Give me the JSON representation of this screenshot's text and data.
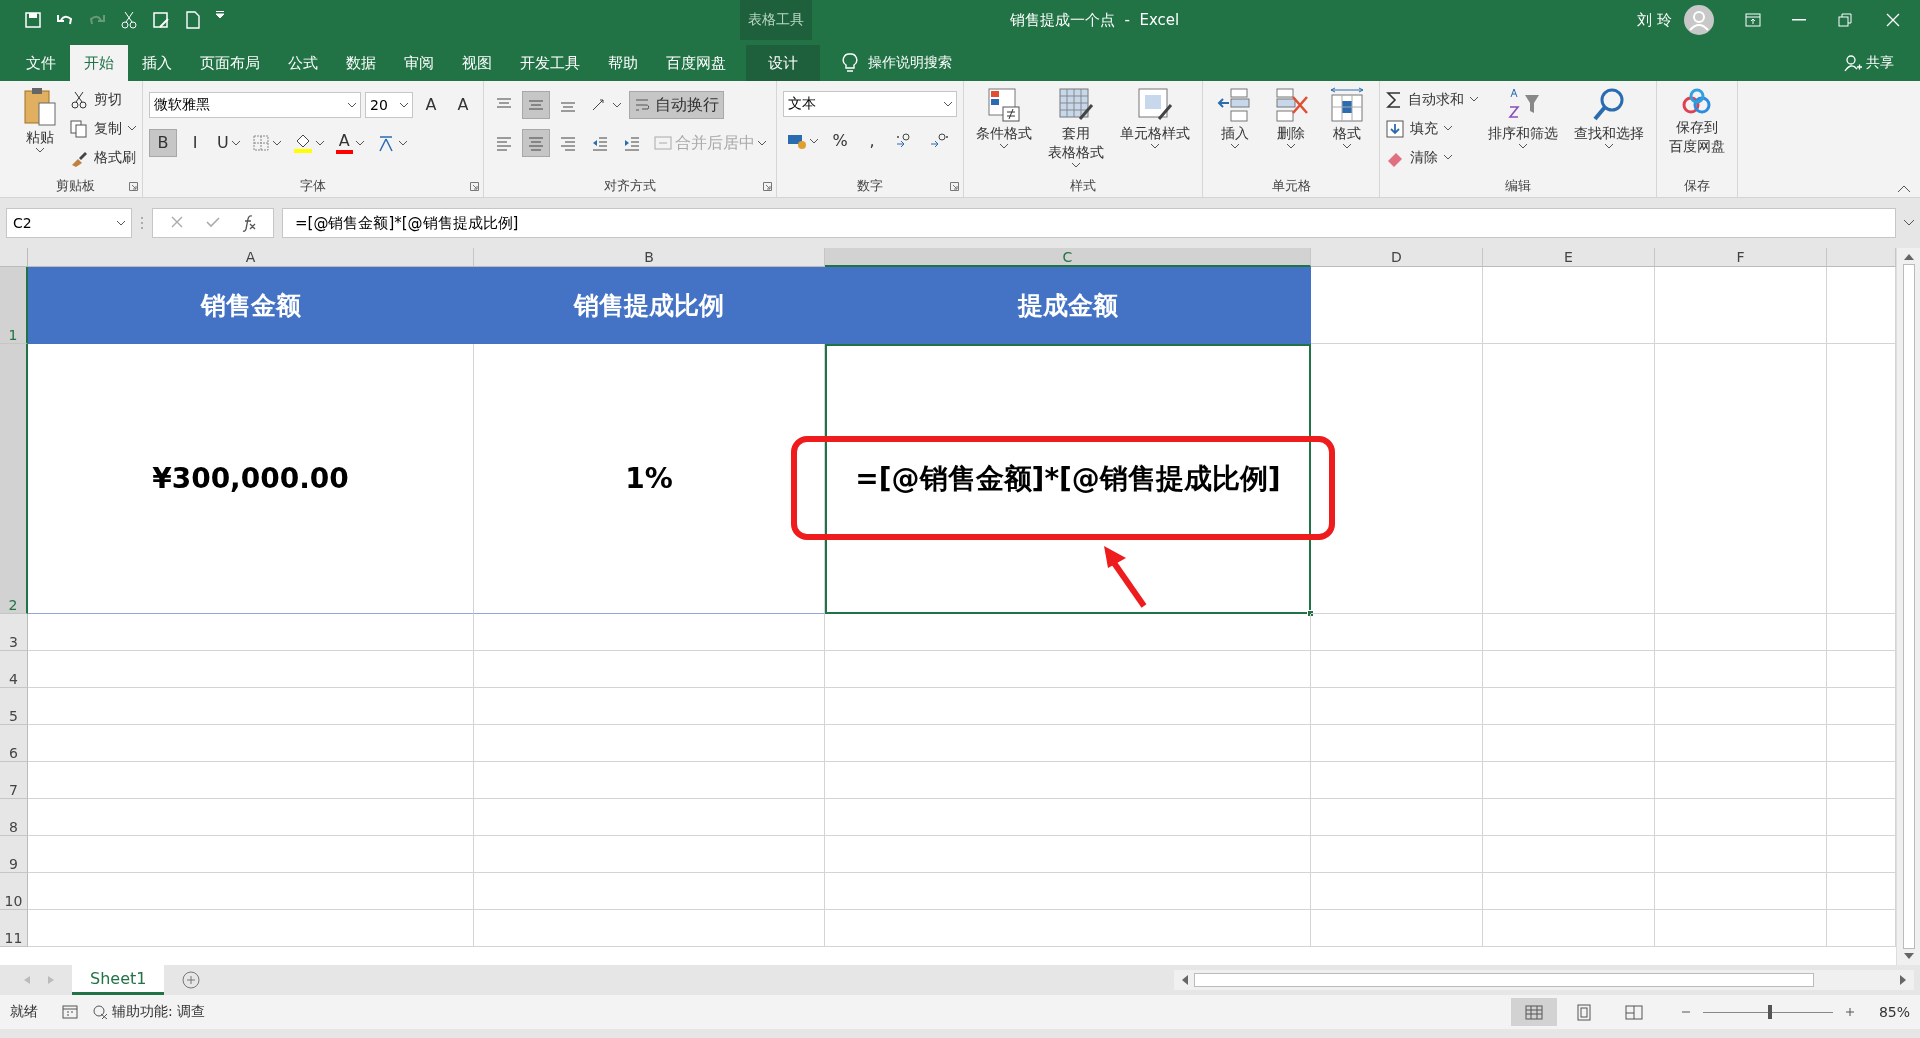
{
  "window": {
    "title": "销售提成一个点  -  Excel",
    "context_tab": "表格工具",
    "user": "刘 玲"
  },
  "tabs": [
    {
      "label": "文件",
      "selected": false
    },
    {
      "label": "开始",
      "selected": true
    },
    {
      "label": "插入",
      "selected": false
    },
    {
      "label": "页面布局",
      "selected": false
    },
    {
      "label": "公式",
      "selected": false
    },
    {
      "label": "数据",
      "selected": false
    },
    {
      "label": "审阅",
      "selected": false
    },
    {
      "label": "视图",
      "selected": false
    },
    {
      "label": "开发工具",
      "selected": false
    },
    {
      "label": "帮助",
      "selected": false
    },
    {
      "label": "百度网盘",
      "selected": false
    },
    {
      "label": "设计",
      "selected": false,
      "kind": "context"
    }
  ],
  "tell_me": {
    "placeholder": "操作说明搜索"
  },
  "share": "共享",
  "ribbon": [
    {
      "label": "剪贴板",
      "launcher": true,
      "items": [
        {
          "kind": "large",
          "lines": [
            "粘贴"
          ],
          "dropdown": true
        },
        {
          "kind": "small",
          "label": "剪切"
        },
        {
          "kind": "small",
          "label": "复制",
          "dropdown": true
        },
        {
          "kind": "small",
          "label": "格式刷"
        }
      ]
    },
    {
      "label": "字体",
      "launcher": true,
      "upper": [
        {
          "kind": "field",
          "value": "微软雅黑"
        },
        {
          "kind": "field",
          "value": "20"
        },
        {
          "kind": "toggle",
          "label": "A"
        },
        {
          "kind": "toggle",
          "label": "A"
        }
      ],
      "lower": [
        {
          "kind": "toggle",
          "label": "B",
          "selected": true
        },
        {
          "kind": "toggle",
          "label": "I"
        },
        {
          "kind": "toggle",
          "label": "U",
          "dropdown": true
        },
        {
          "kind": "toggle",
          "dropdown": true
        },
        {
          "kind": "toggle",
          "dropdown": true,
          "color": "#ffff00"
        },
        {
          "kind": "toggle",
          "label": "A",
          "dropdown": true,
          "color": "#ff0000"
        },
        {
          "kind": "toggle",
          "dropdown": true
        }
      ]
    },
    {
      "label": "对齐方式",
      "launcher": true,
      "upper": [
        {
          "kind": "toggle",
          "selected": false
        },
        {
          "kind": "toggle",
          "selected": true
        },
        {
          "kind": "toggle",
          "selected": false
        },
        {
          "kind": "toggle",
          "dropdown": true
        },
        {
          "kind": "toggle",
          "label": "自动换行",
          "selected": true
        }
      ],
      "lower": [
        {
          "kind": "toggle",
          "selected": false
        },
        {
          "kind": "toggle",
          "selected": true
        },
        {
          "kind": "toggle",
          "selected": false
        },
        {
          "kind": "toggle"
        },
        {
          "kind": "toggle"
        },
        {
          "kind": "toggle",
          "label": "合并后居中",
          "disabled": true,
          "dropdown": true
        }
      ]
    },
    {
      "label": "数字",
      "launcher": true,
      "upper": [
        {
          "kind": "field",
          "value": "文本"
        }
      ],
      "lower": [
        {
          "kind": "toggle",
          "dropdown": true
        },
        {
          "kind": "toggle",
          "label": "%"
        },
        {
          "kind": "toggle",
          "label": ","
        },
        {
          "kind": "toggle"
        },
        {
          "kind": "toggle"
        }
      ]
    },
    {
      "label": "样式",
      "items": [
        {
          "kind": "large",
          "lines": [
            "条件格式"
          ],
          "dropdown": true
        },
        {
          "kind": "large",
          "lines": [
            "套用",
            "表格格式"
          ],
          "dropdown": true
        },
        {
          "kind": "large",
          "lines": [
            "单元格样式"
          ],
          "dropdown": true
        }
      ]
    },
    {
      "label": "单元格",
      "items": [
        {
          "kind": "large",
          "lines": [
            "插入"
          ],
          "dropdown": true
        },
        {
          "kind": "large",
          "lines": [
            "删除"
          ],
          "dropdown": true
        },
        {
          "kind": "large",
          "lines": [
            "格式"
          ],
          "dropdown": true
        }
      ]
    },
    {
      "label": "编辑",
      "items": [
        {
          "kind": "small",
          "label": "自动求和",
          "dropdown": true
        },
        {
          "kind": "small",
          "label": "填充",
          "dropdown": true
        },
        {
          "kind": "small",
          "label": "清除",
          "dropdown": true
        },
        {
          "kind": "large",
          "lines": [
            "排序和筛选"
          ],
          "dropdown": true
        },
        {
          "kind": "large",
          "lines": [
            "查找和选择"
          ],
          "dropdown": true
        }
      ]
    },
    {
      "label": "保存",
      "items": [
        {
          "kind": "large",
          "lines": [
            "保存到",
            "百度网盘"
          ]
        }
      ]
    }
  ],
  "formula_bar": {
    "name_box": "C2",
    "formula": "=[@销售金额]*[@销售提成比例]"
  },
  "sheet": {
    "columns": [
      {
        "label": "A",
        "selected": false
      },
      {
        "label": "B",
        "selected": false
      },
      {
        "label": "C",
        "selected": true
      },
      {
        "label": "D",
        "selected": false
      },
      {
        "label": "E",
        "selected": false
      },
      {
        "label": "F",
        "selected": false
      }
    ],
    "rows": [
      {
        "label": "1",
        "selected": true,
        "kind": "header",
        "cells": [
          "销售金额",
          "销售提成比例",
          "提成金额"
        ]
      },
      {
        "label": "2",
        "selected": true,
        "kind": "data",
        "cells": [
          "¥300,000.00",
          "1%",
          "=[@销售金额]*[@销售提成比例]"
        ]
      },
      {
        "label": "3",
        "selected": false,
        "cells": []
      },
      {
        "label": "4",
        "selected": false,
        "cells": []
      },
      {
        "label": "5",
        "selected": false,
        "cells": []
      },
      {
        "label": "6",
        "selected": false,
        "cells": []
      },
      {
        "label": "7",
        "selected": false,
        "cells": []
      },
      {
        "label": "8",
        "selected": false,
        "cells": []
      },
      {
        "label": "9",
        "selected": false,
        "cells": []
      },
      {
        "label": "10",
        "selected": false,
        "cells": []
      },
      {
        "label": "11",
        "selected": false,
        "cells": []
      }
    ]
  },
  "sheet_tabs": [
    {
      "label": "Sheet1",
      "selected": true
    }
  ],
  "status_bar": {
    "ready": "就绪",
    "accessibility": "辅助功能: 调查",
    "zoom": "85%",
    "zoom_level": {
      "level": 0.5
    },
    "views": [
      {
        "selected": true
      },
      {
        "selected": false
      },
      {
        "selected": false
      }
    ]
  }
}
